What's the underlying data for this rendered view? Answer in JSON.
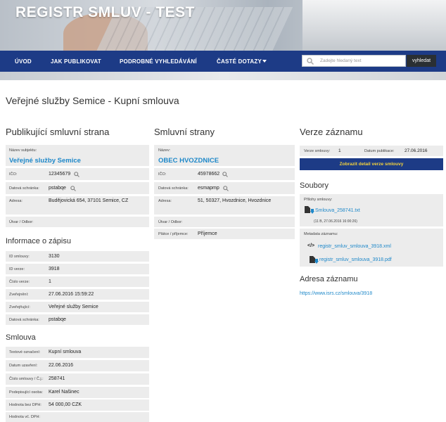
{
  "site_title": "REGISTR SMLUV - TEST",
  "nav": {
    "uvod": "ÚVOD",
    "jak": "JAK PUBLIKOVAT",
    "podrobne": "PODROBNÉ VYHLEDÁVÁNÍ",
    "caste": "ČASTÉ DOTAZY",
    "search_placeholder": "Zadejte hledaný text",
    "search_button": "vyhledat"
  },
  "page_title": "Veřejné služby Semice - Kupní smlouva",
  "publikujici": {
    "heading": "Publikující smluvní strana",
    "nazev_label": "Název subjektu:",
    "nazev": "Veřejné služby Semice",
    "ico_label": "IČO:",
    "ico": "12345679",
    "ds_label": "Datová schránka:",
    "ds": "pstabqe",
    "adresa_label": "Adresa:",
    "adresa": "Budějovická 654, 37101 Semice, CZ",
    "utvar_label": "Útvar / Odbor:"
  },
  "informace": {
    "heading": "Informace o zápisu",
    "id_smlouvy_label": "ID smlouvy:",
    "id_smlouvy": "3130",
    "id_verze_label": "ID verze:",
    "id_verze": "3918",
    "cislo_verze_label": "Číslo verze:",
    "cislo_verze": "1",
    "zverejneni_label": "Zveřejnění:",
    "zverejneni": "27.06.2016 15:59:22",
    "zverejnujici_label": "Zveřejňující:",
    "zverejnujici": "Veřejné služby Semice",
    "ds_label": "Datová schránka:",
    "ds": "pstabqe"
  },
  "smlouva": {
    "heading": "Smlouva",
    "oznaceni_label": "Textové označení:",
    "oznaceni": "Kupní smlouva",
    "datum_label": "Datum uzavření:",
    "datum": "22.06.2016",
    "cislo_label": "Číslo smlouvy / Č.j.:",
    "cislo": "258741",
    "podepsal_label": "Podepisující osoba:",
    "podepsal": "Karel Našinec",
    "bez_dph_label": "Hodnota bez DPH:",
    "bez_dph": "54 000,00 CZK",
    "s_dph_label": "Hodnota vč. DPH:"
  },
  "strany": {
    "heading": "Smluvní strany",
    "nazev_label": "Název:",
    "nazev": "OBEC HVOZDNICE",
    "ico_label": "IČO:",
    "ico": "45978662",
    "ds_label": "Datová schránka:",
    "ds": "esmapmp",
    "adresa_label": "Adresa:",
    "adresa": "51, 50327, Hvozdnice, Hvozdnice",
    "utvar_label": "Útvar / Odbor:",
    "platce_label": "Plátce / příjemce:",
    "platce": "Příjemce"
  },
  "verze": {
    "heading": "Verze záznamu",
    "verze_label": "Verze smlouvy:",
    "verze": "1",
    "datum_label": "Datum publikace:",
    "datum": "27.06.2016",
    "detail_button": "Zobrazit detail verze smlouvy"
  },
  "soubory": {
    "heading": "Soubory",
    "prilohy_label": "Přílohy smlouvy:",
    "priloha_name": "Smlouva_258741.txt",
    "priloha_info": "(11 B, 27.06.2016 16:00:26)",
    "metadata_label": "Metadata záznamu:",
    "xml": "registr_smluv_smlouva_3918.xml",
    "pdf": "registr_smluv_smlouva_3918.pdf"
  },
  "adresa": {
    "heading": "Adresa záznamu",
    "url": "https://www.isrs.cz/smlouva/3918"
  },
  "colors": {
    "nav": "#1d3b86",
    "link": "#1e88c9",
    "button_text": "#f5d33b",
    "row": "#ececec"
  }
}
